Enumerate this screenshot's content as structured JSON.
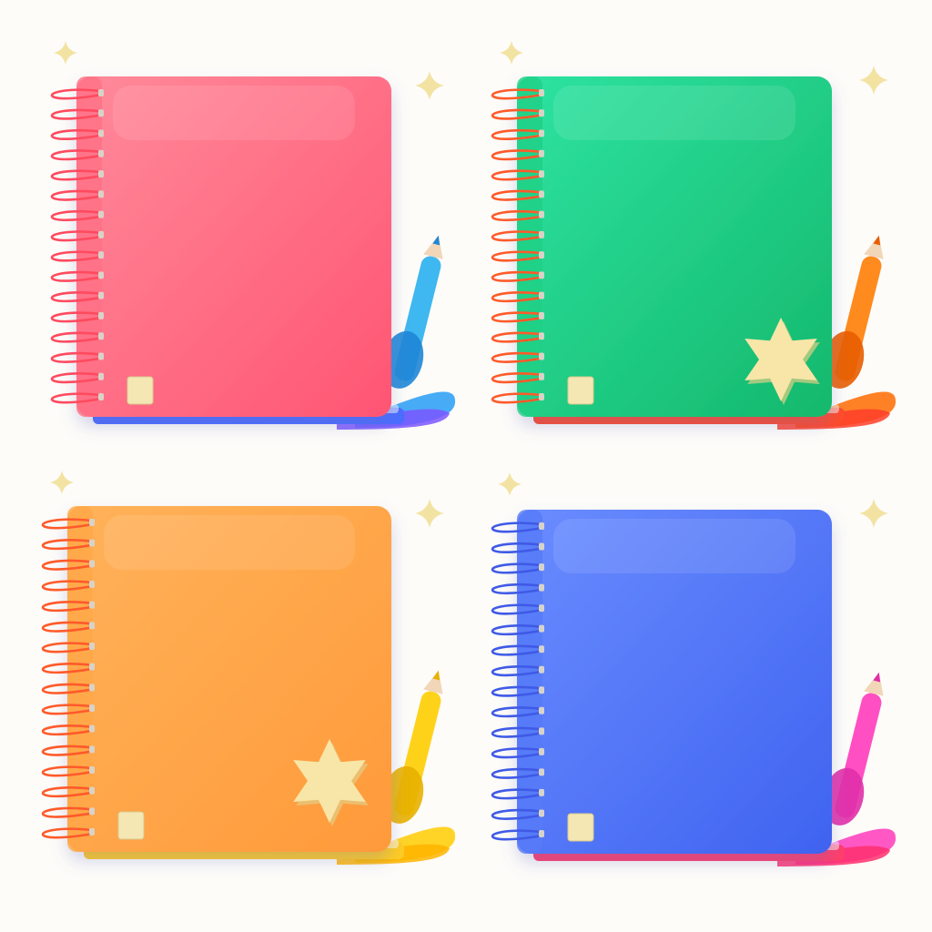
{
  "notebooks": [
    {
      "id": "notebook-pink",
      "cover_top": "#ff8a9a",
      "cover_bottom": "#ff5573",
      "spine": "#ff7186",
      "pages_edge": "#4a6cff",
      "ring": "#ff4a5f",
      "pen": "#3fb7f0",
      "pen_dark": "#1f86d6",
      "puddle_a": "#3ea6f5",
      "puddle_b": "#7b56ff",
      "has_star": false
    },
    {
      "id": "notebook-green",
      "cover_top": "#2ee3a1",
      "cover_bottom": "#14b86c",
      "spine": "#1fcf86",
      "pages_edge": "#ff4a2a",
      "ring": "#ff5a2a",
      "pen": "#ff8a1e",
      "pen_dark": "#e85d00",
      "puddle_a": "#ff7a1a",
      "puddle_b": "#ff3e2a",
      "has_star": true
    },
    {
      "id": "notebook-orange",
      "cover_top": "#ffb25a",
      "cover_bottom": "#ff9a3a",
      "spine": "#ffa849",
      "pages_edge": "#ffcc22",
      "ring": "#ff5a2a",
      "pen": "#ffd21a",
      "pen_dark": "#e8b000",
      "puddle_a": "#ffd21a",
      "puddle_b": "#ffb400",
      "has_star": true
    },
    {
      "id": "notebook-blue",
      "cover_top": "#6a8cff",
      "cover_bottom": "#3f63f0",
      "spine": "#567af7",
      "pages_edge": "#ff3e6a",
      "ring": "#3f5ae6",
      "pen": "#ff4fc2",
      "pen_dark": "#e02fa8",
      "puddle_a": "#ff4fc2",
      "puddle_b": "#ff2f6f",
      "has_star": false
    }
  ],
  "accents": {
    "sparkle": "#f3e3a3",
    "star_fill": "#f7e6a8",
    "star_shade": "#e3cd85",
    "sticky_square": "#f4e7b4"
  }
}
